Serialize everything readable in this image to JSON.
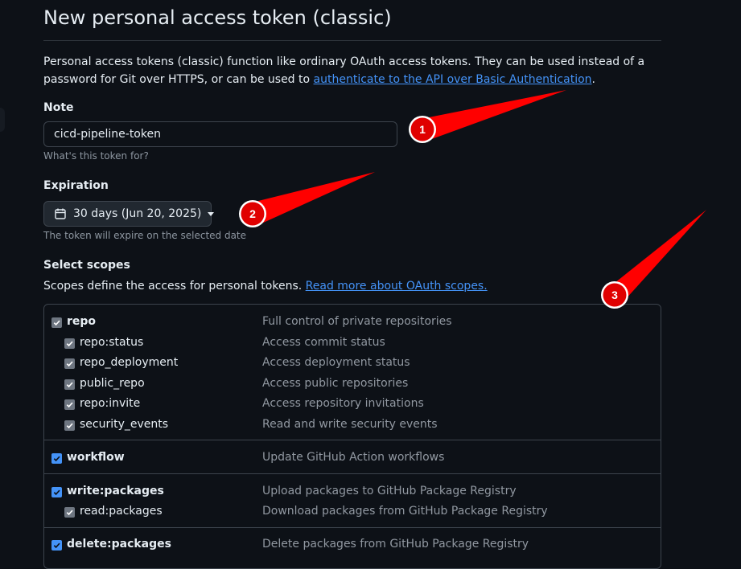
{
  "header": {
    "title": "New personal access token (classic)"
  },
  "intro": {
    "text_before": "Personal access tokens (classic) function like ordinary OAuth access tokens. They can be used instead of a password for Git over HTTPS, or can be used to ",
    "link": "authenticate to the API over Basic Authentication",
    "text_after": "."
  },
  "note": {
    "label": "Note",
    "value": "cicd-pipeline-token",
    "hint": "What's this token for?"
  },
  "expiration": {
    "label": "Expiration",
    "value": "30 days (Jun 20, 2025)",
    "hint": "The token will expire on the selected date"
  },
  "scopes": {
    "label": "Select scopes",
    "description": "Scopes define the access for personal tokens. ",
    "link": "Read more about OAuth scopes.",
    "groups": [
      {
        "name": "repo",
        "description": "Full control of private repositories",
        "checked": true,
        "children": [
          {
            "name": "repo:status",
            "description": "Access commit status"
          },
          {
            "name": "repo_deployment",
            "description": "Access deployment status"
          },
          {
            "name": "public_repo",
            "description": "Access public repositories"
          },
          {
            "name": "repo:invite",
            "description": "Access repository invitations"
          },
          {
            "name": "security_events",
            "description": "Read and write security events"
          }
        ]
      },
      {
        "name": "workflow",
        "description": "Update GitHub Action workflows",
        "checked": true,
        "children": []
      },
      {
        "name": "write:packages",
        "description": "Upload packages to GitHub Package Registry",
        "checked": true,
        "children": [
          {
            "name": "read:packages",
            "description": "Download packages from GitHub Package Registry"
          }
        ]
      },
      {
        "name": "delete:packages",
        "description": "Delete packages from GitHub Package Registry",
        "checked": true,
        "children": []
      }
    ]
  },
  "annotations": {
    "markers": [
      "1",
      "2",
      "3"
    ],
    "color": "#ff0000"
  },
  "colors": {
    "accent": "#4493f8",
    "background": "#0d1117"
  },
  "icons": {
    "expiration": "calendar-icon",
    "dropdown": "caret-down-icon",
    "checkbox": "check-icon"
  }
}
